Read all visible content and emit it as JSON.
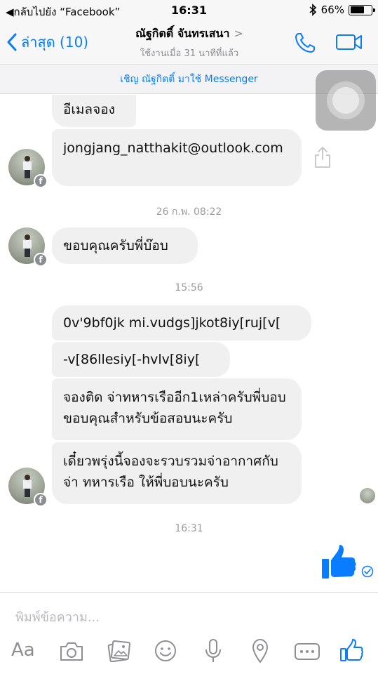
{
  "status_bar": {
    "back_app": "◀กลับไปยัง “Facebook”",
    "time": "16:31",
    "battery": "66%",
    "battery_level": 0.66
  },
  "nav": {
    "back_label": "ล่าสุด (10)",
    "contact_name": "ณัฐกิตติ์ จันทรเสนา",
    "contact_chevron": ">",
    "last_active": "ใช้งานเมื่อ 31 นาทีที่แล้ว"
  },
  "invite_bar": "เชิญ ณัฐกิตติ์ มาใช้ Messenger",
  "messages": [
    {
      "text": "อีเมลจอง"
    },
    {
      "text": "jongjang_natthakit@outlook.com"
    },
    {
      "text": "ขอบคุณครับพี่บ๊อบ"
    },
    {
      "text": "0v'9bf0jk mi.vudgs]jkot8iy[ruj[v["
    },
    {
      "text": "-v[86llesiy[-hvlv[8iy["
    },
    {
      "text": "จองติด จ่าทหารเรืออีก1เหล่าครับพี่บอบขอบคุณสำหรับข้อสอบนะครับ"
    },
    {
      "text": "เดี๋ยวพรุ่งนี้จองจะรวบรวมจ่าอากาศกับจ่า ทหารเรือ ให้พี่บอบนะครับ"
    }
  ],
  "timestamps": [
    "26 ก.พ. 08:22",
    "15:56",
    "16:31"
  ],
  "composer": {
    "placeholder": "พิมพ์ข้อความ...",
    "aa_label": "Aa"
  },
  "colors": {
    "accent": "#0a7cff",
    "bubble_bg": "#f1f0f0"
  }
}
